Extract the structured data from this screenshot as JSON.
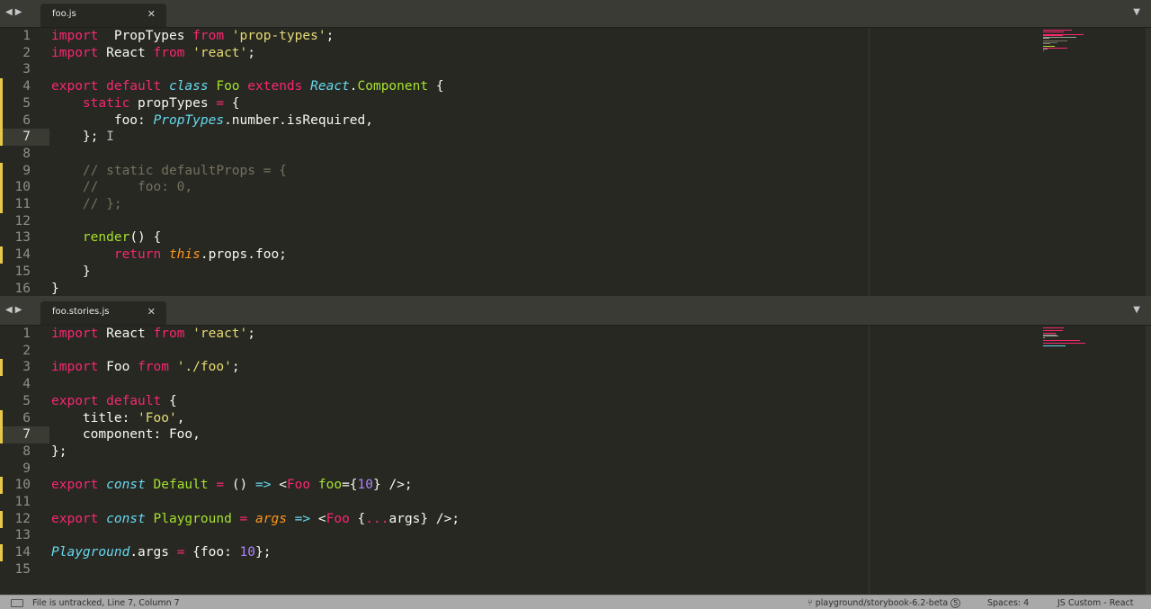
{
  "pane1": {
    "tab_nav": "◀▶",
    "tab_label": "foo.js",
    "tab_close": "✕",
    "dropdown": "▼",
    "current_line": 7,
    "modified_lines": [
      4,
      5,
      6,
      7,
      9,
      10,
      11,
      14
    ],
    "lines": [
      [
        [
          "kw",
          "import"
        ],
        [
          "",
          "  PropTypes "
        ],
        [
          "kw",
          "from"
        ],
        [
          "",
          ""
        ],
        [
          "str",
          " 'prop-types'"
        ],
        [
          "",
          ";"
        ]
      ],
      [
        [
          "kw",
          "import"
        ],
        [
          "",
          " React "
        ],
        [
          "kw",
          "from"
        ],
        [
          "str",
          " 'react'"
        ],
        [
          "",
          ";"
        ]
      ],
      [],
      [
        [
          "kw",
          "export default "
        ],
        [
          "it",
          "class "
        ],
        [
          "cls",
          "Foo"
        ],
        [
          "kw",
          " extends "
        ],
        [
          "it",
          "React"
        ],
        [
          "",
          "."
        ],
        [
          "cls",
          "Component"
        ],
        [
          "",
          " {"
        ]
      ],
      [
        [
          "",
          ""
        ],
        [
          "kw",
          "    static"
        ],
        [
          "",
          " propTypes "
        ],
        [
          "kw",
          "="
        ],
        [
          "",
          " {"
        ]
      ],
      [
        [
          "",
          "        foo: "
        ],
        [
          "it",
          "PropTypes"
        ],
        [
          "",
          ".number.isRequired,"
        ]
      ],
      [
        [
          "",
          "    }; "
        ],
        [
          "cursor",
          "I"
        ]
      ],
      [],
      [
        [
          "cm",
          "    // static defaultProps = {"
        ]
      ],
      [
        [
          "cm",
          "    //     foo: 0,"
        ]
      ],
      [
        [
          "cm",
          "    // };"
        ]
      ],
      [],
      [
        [
          "fn",
          "    render"
        ],
        [
          "",
          "() {"
        ]
      ],
      [
        [
          "kw",
          "        return "
        ],
        [
          "par",
          "this"
        ],
        [
          "",
          ".props.foo;"
        ]
      ],
      [
        [
          "",
          "    }"
        ]
      ],
      [
        [
          "",
          "}"
        ]
      ]
    ]
  },
  "pane2": {
    "tab_nav": "◀▶",
    "tab_label": "foo.stories.js",
    "tab_close": "✕",
    "dropdown": "▼",
    "current_line": 7,
    "modified_lines": [
      3,
      6,
      7,
      10,
      12,
      14
    ],
    "lines": [
      [
        [
          "kw",
          "import"
        ],
        [
          "",
          " React "
        ],
        [
          "kw",
          "from"
        ],
        [
          "str",
          " 'react'"
        ],
        [
          "",
          ";"
        ]
      ],
      [],
      [
        [
          "kw",
          "import"
        ],
        [
          "",
          " Foo "
        ],
        [
          "kw",
          "from"
        ],
        [
          "str",
          " './foo'"
        ],
        [
          "",
          ";"
        ]
      ],
      [],
      [
        [
          "kw",
          "export default"
        ],
        [
          "",
          " {"
        ]
      ],
      [
        [
          "",
          "    title: "
        ],
        [
          "str",
          "'Foo'"
        ],
        [
          "",
          ","
        ]
      ],
      [
        [
          "",
          "    component: Foo,"
        ]
      ],
      [
        [
          "",
          "};"
        ]
      ],
      [],
      [
        [
          "kw",
          "export "
        ],
        [
          "it",
          "const "
        ],
        [
          "cls",
          "Default"
        ],
        [
          "kw",
          " = "
        ],
        [
          "",
          "() "
        ],
        [
          "it",
          "=>"
        ],
        [
          "",
          " <"
        ],
        [
          "kw",
          "Foo"
        ],
        [
          "",
          ""
        ],
        [
          "cls",
          " foo"
        ],
        [
          "",
          "={"
        ],
        [
          "num",
          "10"
        ],
        [
          "",
          "} />;"
        ]
      ],
      [],
      [
        [
          "kw",
          "export "
        ],
        [
          "it",
          "const "
        ],
        [
          "cls",
          "Playground"
        ],
        [
          "kw",
          " = "
        ],
        [
          "par",
          "args"
        ],
        [
          "it",
          " =>"
        ],
        [
          "",
          " <"
        ],
        [
          "kw",
          "Foo"
        ],
        [
          "",
          " {"
        ],
        [
          "kw",
          "..."
        ],
        [
          "",
          "args} />;"
        ]
      ],
      [],
      [
        [
          "it",
          "Playground"
        ],
        [
          "",
          ".args "
        ],
        [
          "kw",
          "="
        ],
        [
          "",
          " {foo: "
        ],
        [
          "num",
          "10"
        ],
        [
          "",
          "};"
        ]
      ],
      []
    ]
  },
  "status": {
    "message": "File is untracked, Line 7, Column 7",
    "branch": "playground/storybook-6.2-beta",
    "branch_badge": "5",
    "spaces": "Spaces: 4",
    "syntax": "JS Custom - React"
  }
}
